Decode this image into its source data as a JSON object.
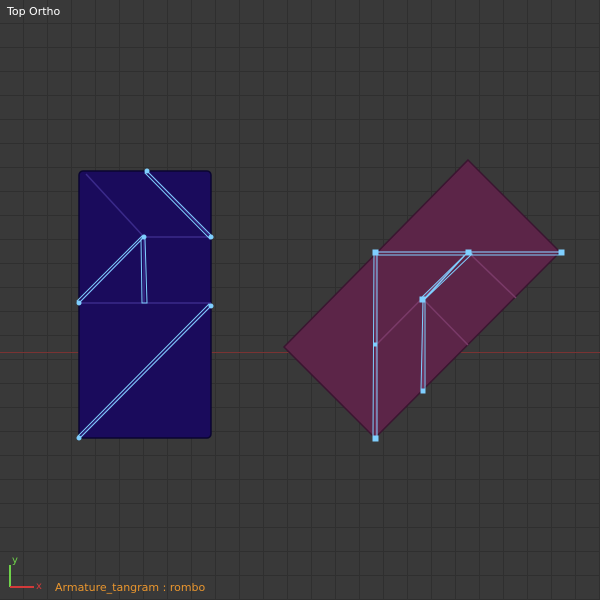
{
  "viewport": {
    "view_name": "Top Ortho",
    "active_object": "Armature_tangram : rombo"
  },
  "gizmo": {
    "y_label": "y",
    "x_label": "x"
  },
  "colors": {
    "background": "#393939",
    "grid": "#2f2f2f",
    "x_axis": "#7a3333",
    "left_model": "#1a0b5c",
    "right_model": "#5c2548",
    "bones": "#7fcfff",
    "label_orange": "#e8952e"
  }
}
